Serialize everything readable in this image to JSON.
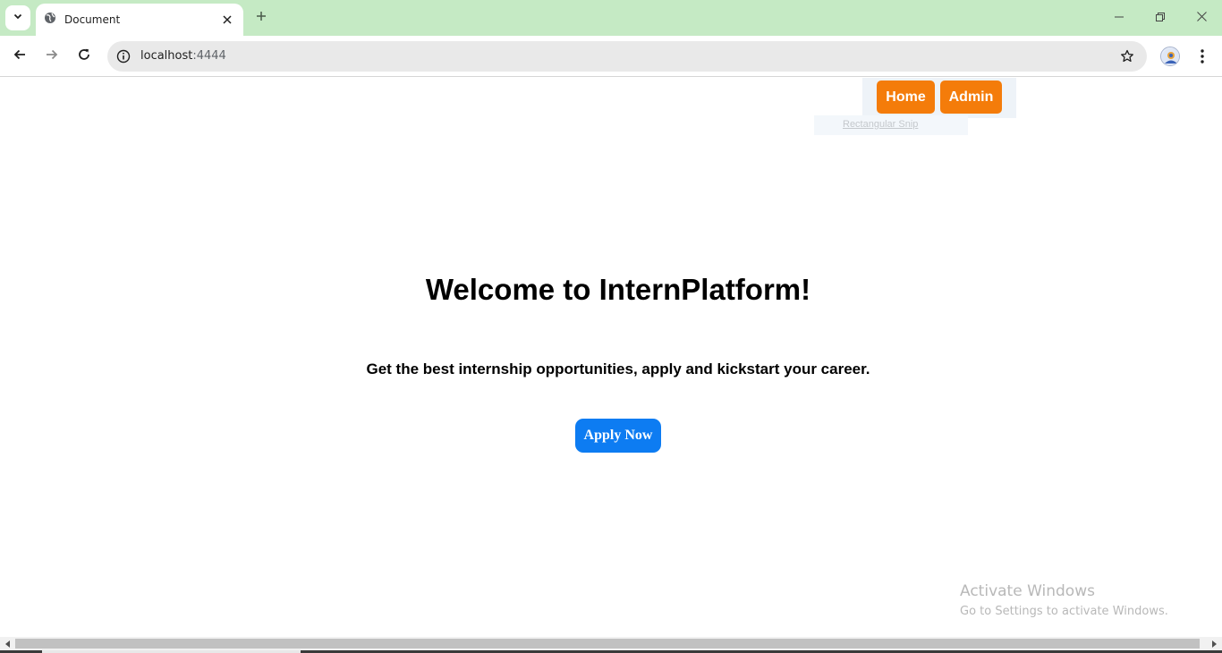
{
  "browser": {
    "tab": {
      "title": "Document"
    },
    "url": {
      "host": "localhost",
      "port": ":4444"
    }
  },
  "nav": {
    "home_label": "Home",
    "admin_label": "Admin"
  },
  "overlay": {
    "snip_label": "Rectangular Snip"
  },
  "hero": {
    "title": "Welcome to InternPlatform!",
    "subtitle": "Get the best internship opportunities, apply and kickstart your career.",
    "apply_label": "Apply Now"
  },
  "watermark": {
    "title": "Activate Windows",
    "subtitle": "Go to Settings to activate Windows."
  },
  "colors": {
    "nav_button": "#f47c0a",
    "apply_button": "#0d7cf2",
    "tabstrip": "#c5eac4"
  },
  "icons": [
    "tab-search-icon",
    "globe-icon",
    "close-icon",
    "plus-icon",
    "minimize-icon",
    "restore-icon",
    "window-close-icon",
    "back-arrow-icon",
    "forward-arrow-icon",
    "reload-icon",
    "info-icon",
    "star-icon",
    "profile-avatar-icon",
    "kebab-menu-icon"
  ]
}
